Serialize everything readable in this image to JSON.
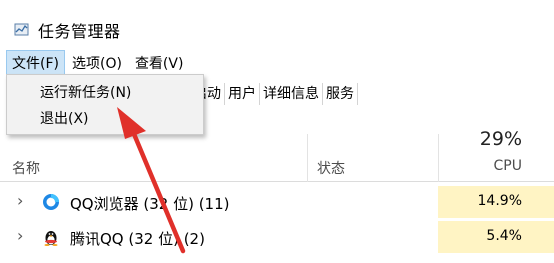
{
  "window": {
    "title": "任务管理器",
    "icon": "task-manager-icon"
  },
  "menubar": {
    "items": [
      "文件(F)",
      "选项(O)",
      "查看(V)"
    ]
  },
  "file_menu": {
    "items": [
      "运行新任务(N)",
      "退出(X)"
    ]
  },
  "tabs": [
    "启动",
    "用户",
    "详细信息",
    "服务"
  ],
  "table": {
    "headers": {
      "name": "名称",
      "status": "状态",
      "cpu_percent": "29%",
      "cpu": "CPU"
    },
    "rows": [
      {
        "name": "QQ浏览器 (32 位) (11)",
        "status": "",
        "cpu": "14.9%",
        "icon": "qq-browser-icon"
      },
      {
        "name": "腾讯QQ (32 位) (2)",
        "status": "",
        "cpu": "5.4%",
        "icon": "qq-penguin-icon"
      }
    ]
  },
  "colors": {
    "menu_highlight": "#cce4f7",
    "cpu_cell": "#fff4c4",
    "annotation_arrow": "#e0302a"
  }
}
